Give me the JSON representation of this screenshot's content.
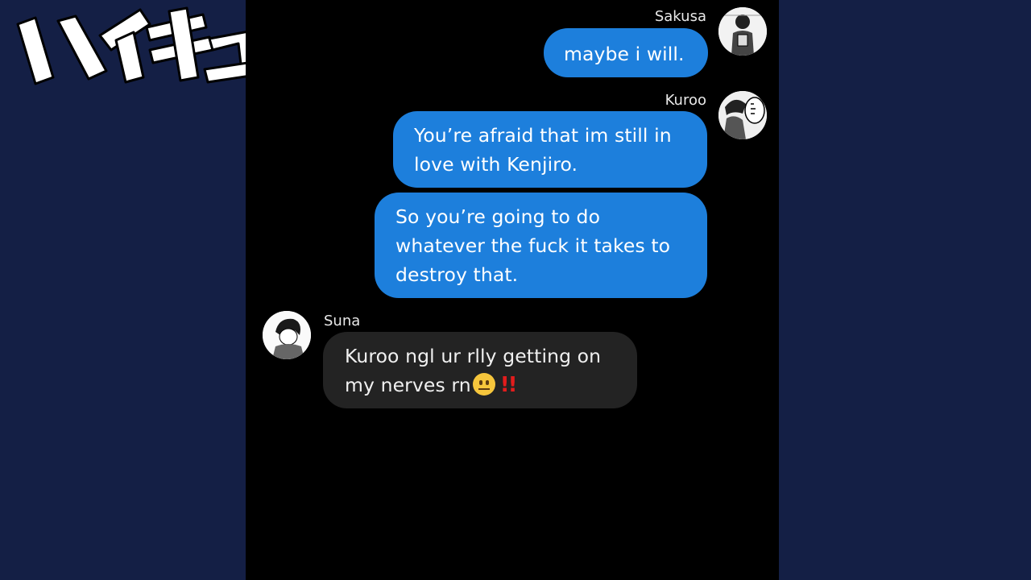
{
  "logo": {
    "text": "ハイキュー!!"
  },
  "messages": [
    {
      "sender": "Sakusa",
      "side": "right",
      "lines": [
        "maybe i will."
      ],
      "avatar_icon": "sakusa-avatar-icon"
    },
    {
      "sender": "Kuroo",
      "side": "right",
      "lines": [
        "You’re afraid that im still in",
        "love with Kenjiro."
      ],
      "avatar_icon": "kuroo-avatar-icon"
    },
    {
      "sender": "",
      "side": "right",
      "lines": [
        "So you’re going to do",
        "whatever the fuck it takes to",
        "destroy that."
      ]
    },
    {
      "sender": "Suna",
      "side": "left",
      "lines": [
        "Kuroo ngl ur rlly getting on",
        "my nerves rn"
      ],
      "emojis": [
        "neutral-face-emoji",
        "double-exclamation-emoji"
      ],
      "avatar_icon": "suna-avatar-icon"
    }
  ],
  "colors": {
    "background_side": "#141f45",
    "chat_background": "#000000",
    "outgoing_bubble": "#1d7fdc",
    "incoming_bubble": "#232323",
    "exclamation": "#e31c1c"
  }
}
